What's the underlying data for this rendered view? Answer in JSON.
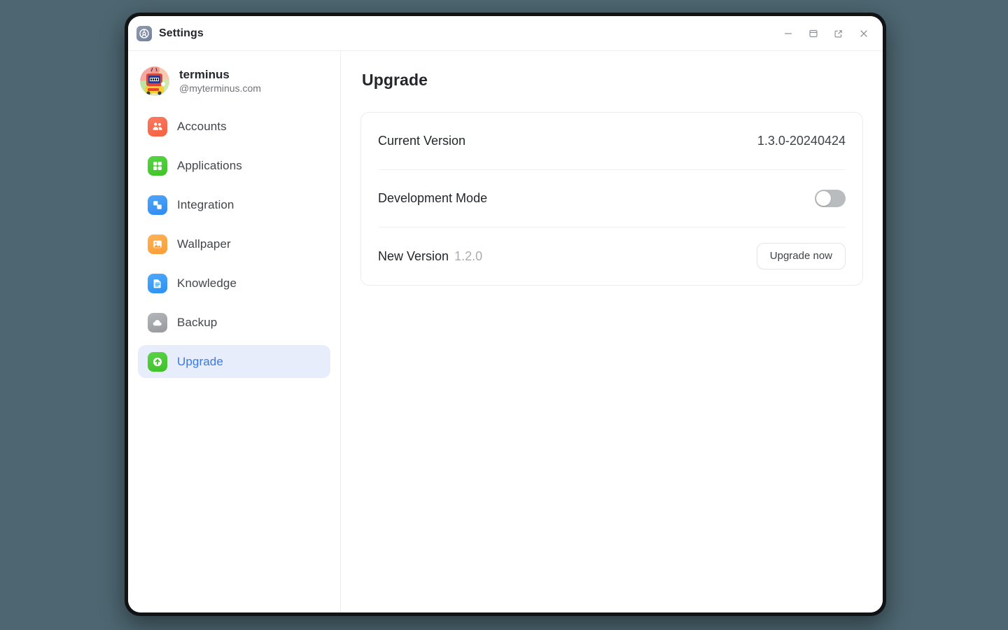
{
  "window": {
    "app_icon": "settings-gear-icon",
    "title": "Settings",
    "controls": [
      {
        "name": "minimize-button",
        "icon": "minimize-icon"
      },
      {
        "name": "maximize-button",
        "icon": "maximize-icon"
      },
      {
        "name": "popout-button",
        "icon": "external-link-icon"
      },
      {
        "name": "close-button",
        "icon": "close-icon"
      }
    ]
  },
  "sidebar": {
    "profile": {
      "avatar": "user-avatar-illustration",
      "name": "terminus",
      "handle": "@myterminus.com"
    },
    "items": [
      {
        "label": "Accounts",
        "icon": "people-icon",
        "selected": false
      },
      {
        "label": "Applications",
        "icon": "grid-icon",
        "selected": false
      },
      {
        "label": "Integration",
        "icon": "puzzle-icon",
        "selected": false
      },
      {
        "label": "Wallpaper",
        "icon": "image-icon",
        "selected": false
      },
      {
        "label": "Knowledge",
        "icon": "document-icon",
        "selected": false
      },
      {
        "label": "Backup",
        "icon": "cloud-icon",
        "selected": false
      },
      {
        "label": "Upgrade",
        "icon": "upload-arrow-icon",
        "selected": true
      }
    ]
  },
  "main": {
    "title": "Upgrade",
    "rows": {
      "current_version": {
        "label": "Current Version",
        "value": "1.3.0-20240424"
      },
      "development_mode": {
        "label": "Development Mode",
        "toggle_state": "off"
      },
      "new_version": {
        "label": "New Version",
        "value": "1.2.0",
        "button_label": "Upgrade now"
      }
    }
  },
  "colors": {
    "page_background": "#4d6671",
    "accent_blue": "#3479ef",
    "selected_row_background": "#e8edfb",
    "toggle_off_track": "#b9bcbe"
  }
}
